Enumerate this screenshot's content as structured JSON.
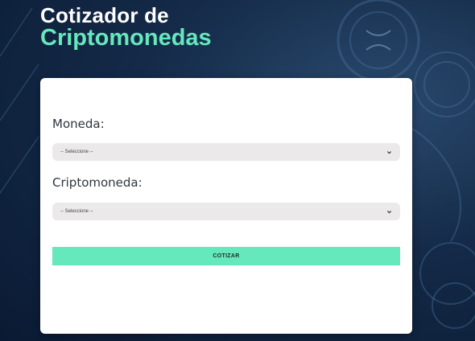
{
  "header": {
    "title_line1": "Cotizador de",
    "title_line2": "Criptomonedas"
  },
  "form": {
    "moneda": {
      "label": "Moneda:",
      "selected": "-- Seleccione --"
    },
    "criptomoneda": {
      "label": "Criptomoneda:",
      "selected": "-- Seleccione --"
    },
    "submit_label": "COTIZAR"
  },
  "colors": {
    "accent": "#66e8bd",
    "background": "#0d1f3b",
    "card": "#ffffff",
    "select_bg": "#ece9ea"
  },
  "icons": [
    "chevron-down-icon",
    "coin-icon"
  ]
}
